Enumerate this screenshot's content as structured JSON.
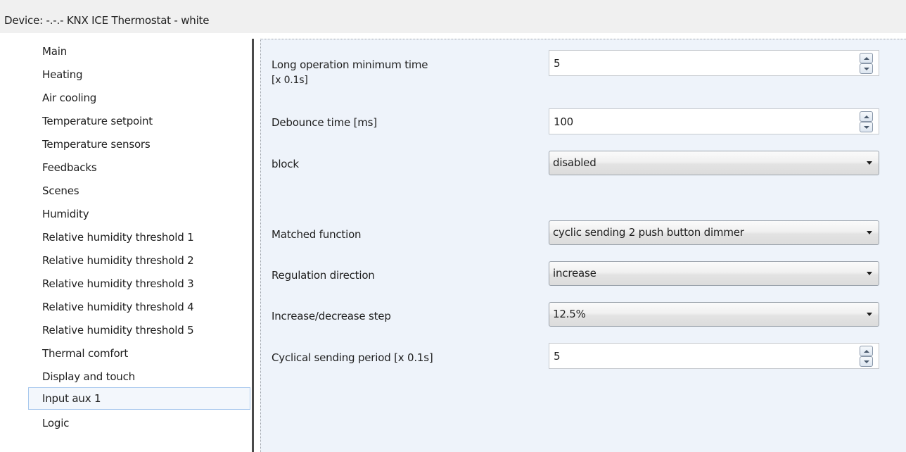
{
  "window": {
    "title": "Device: -.-.-  KNX ICE Thermostat - white"
  },
  "sidebar": {
    "items": [
      {
        "label": "Main",
        "selected": false
      },
      {
        "label": "Heating",
        "selected": false
      },
      {
        "label": "Air cooling",
        "selected": false
      },
      {
        "label": "Temperature setpoint",
        "selected": false
      },
      {
        "label": "Temperature sensors",
        "selected": false
      },
      {
        "label": "Feedbacks",
        "selected": false
      },
      {
        "label": "Scenes",
        "selected": false
      },
      {
        "label": "Humidity",
        "selected": false
      },
      {
        "label": "Relative humidity threshold 1",
        "selected": false
      },
      {
        "label": "Relative humidity threshold 2",
        "selected": false
      },
      {
        "label": "Relative humidity threshold 3",
        "selected": false
      },
      {
        "label": "Relative humidity threshold 4",
        "selected": false
      },
      {
        "label": "Relative humidity threshold 5",
        "selected": false
      },
      {
        "label": "Thermal comfort",
        "selected": false
      },
      {
        "label": "Display and touch",
        "selected": false
      },
      {
        "label": "Input aux 1",
        "selected": true
      },
      {
        "label": "Logic",
        "selected": false
      }
    ]
  },
  "params": {
    "long_operation": {
      "label_line1": "Long operation minimum time",
      "label_line2": "[x 0.1s]",
      "value": "5",
      "icon_up": "spin-up-icon",
      "icon_down": "spin-down-icon"
    },
    "debounce": {
      "label": "Debounce time [ms]",
      "value": "100"
    },
    "block": {
      "label": "block",
      "value": "disabled"
    },
    "matched_function": {
      "label": "Matched function",
      "value": "cyclic sending 2 push button dimmer"
    },
    "regulation_direction": {
      "label": "Regulation direction",
      "value": "increase"
    },
    "step": {
      "label": "Increase/decrease step",
      "value": "12.5%"
    },
    "cyclical_period": {
      "label": "Cyclical sending period [x 0.1s]",
      "value": "5"
    }
  },
  "colors": {
    "content_background": "#eef3fa",
    "selection_border": "#a9c9ee",
    "selection_fill": "#f3f7fc"
  }
}
